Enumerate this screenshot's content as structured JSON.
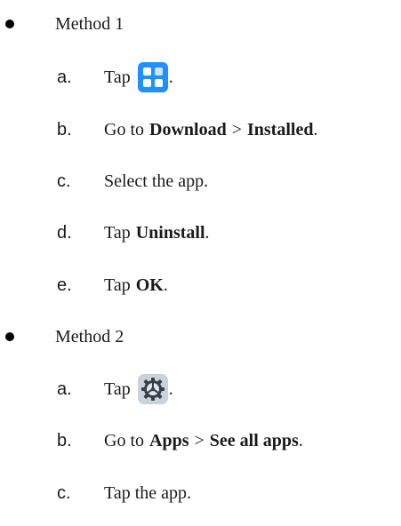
{
  "method1": {
    "title": "Method 1",
    "steps": [
      {
        "letter": "a.",
        "text": "Tap",
        "icon": "app-center-icon",
        "suffix": "."
      },
      {
        "letter": "b.",
        "prefix": "Go to",
        "bold1": "Download",
        "sep": ">",
        "bold2": "Installed",
        "suffix": "."
      },
      {
        "letter": "c.",
        "text": "Select the app."
      },
      {
        "letter": "d.",
        "prefix": "Tap",
        "bold1": "Uninstall",
        "suffix": "."
      },
      {
        "letter": "e.",
        "prefix": "Tap",
        "bold1": "OK",
        "suffix": "."
      }
    ]
  },
  "method2": {
    "title": "Method 2",
    "steps": [
      {
        "letter": "a.",
        "text": "Tap",
        "icon": "settings-gear-icon",
        "suffix": "."
      },
      {
        "letter": "b.",
        "prefix": "Go to",
        "bold1": "Apps",
        "sep": ">",
        "bold2": "See all apps",
        "suffix": "."
      },
      {
        "letter": "c.",
        "text": "Tap the app."
      }
    ]
  },
  "colors": {
    "app_icon_bg": "#1e90ff",
    "settings_icon_bg": "#c9d3dc",
    "text": "#1a1a1a"
  }
}
